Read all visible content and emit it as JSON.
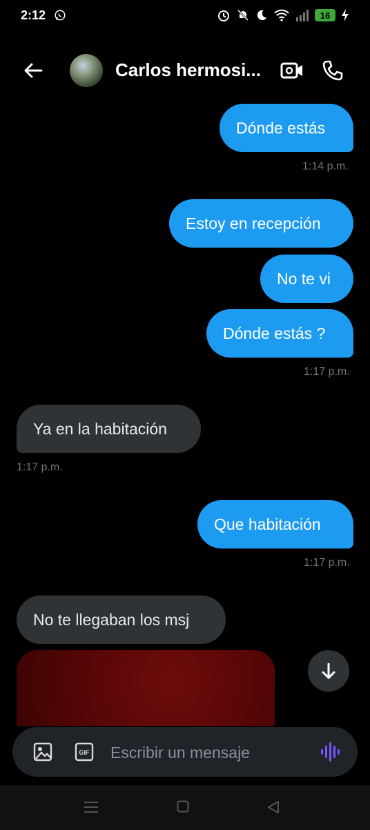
{
  "status_bar": {
    "time": "2:12",
    "battery": "16"
  },
  "header": {
    "contact_name": "Carlos hermosi..."
  },
  "messages": [
    {
      "text": "Dónde estás",
      "direction": "out"
    },
    {
      "timestamp": "1:14 p.m."
    },
    {
      "text": "Estoy en recepción",
      "direction": "out"
    },
    {
      "text": "No te vi",
      "direction": "out"
    },
    {
      "text": "Dónde estás ?",
      "direction": "out"
    },
    {
      "timestamp": "1:17 p.m."
    },
    {
      "text": "Ya en la habitación",
      "direction": "in"
    },
    {
      "timestamp": "1:17 p.m."
    },
    {
      "text": "Que habitación",
      "direction": "out"
    },
    {
      "timestamp": "1:17 p.m."
    },
    {
      "text": "No te llegaban los msj",
      "direction": "in"
    }
  ],
  "composer": {
    "placeholder": "Escribir un mensaje"
  },
  "colors": {
    "outgoing_bubble": "#1d9bf0",
    "incoming_bubble": "#2f3336",
    "background": "#000000",
    "voice_accent": "#7856ff"
  },
  "icons": [
    "whatsapp-icon",
    "alarm-icon",
    "mute-icon",
    "moon-icon",
    "wifi-icon",
    "signal-icon",
    "charging-icon",
    "back-arrow-icon",
    "video-call-icon",
    "phone-call-icon",
    "scroll-down-icon",
    "image-icon",
    "gif-icon",
    "voice-icon"
  ]
}
